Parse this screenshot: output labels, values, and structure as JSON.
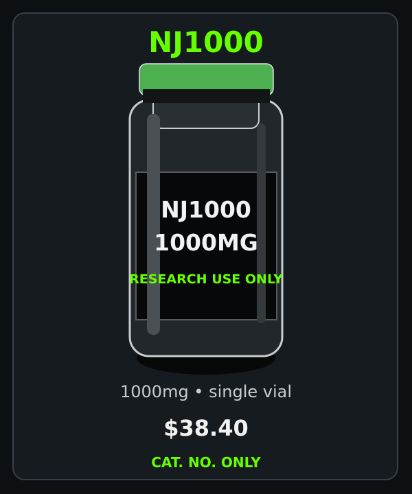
{
  "product": {
    "title": "NJ1000",
    "label_name": "NJ1000",
    "label_dose": "1000MG",
    "label_note": "RESEARCH USE ONLY",
    "description": "1000mg • single vial",
    "price": "$38.40",
    "catalog_note": "CAT. NO. ONLY"
  },
  "colors": {
    "accent": "#66ff00",
    "cap": "#4caf50",
    "background": "#0c1013",
    "card": "#161b1f",
    "vial_outline": "#c9cdd0",
    "label_bg": "#070809"
  }
}
